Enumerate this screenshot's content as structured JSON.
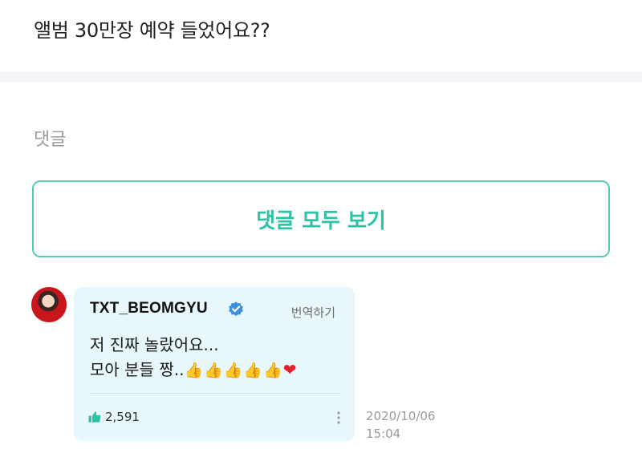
{
  "post": {
    "text": "앨범 30만장 예약 들었어요??"
  },
  "comments_section": {
    "label": "댓글",
    "view_all_label": "댓글 모두 보기"
  },
  "comment": {
    "author": "TXT_BEOMGYU",
    "translate_label": "번역하기",
    "line1": "저 진짜 놀랐어요...",
    "line2": "모아 분들 짱..",
    "emoji_thumbs": "👍👍👍👍👍",
    "emoji_heart": "❤",
    "likes": "2,591",
    "date": "2020/10/06",
    "time": "15:04"
  },
  "icons": {
    "verified": "verified-check-icon",
    "like": "thumbs-up-icon",
    "more": "more-vertical-icon"
  },
  "colors": {
    "accent": "#2cc2a6",
    "accent_border": "#56cdb6",
    "bubble_bg": "#e8f7fc",
    "verified_blue": "#3d8fe0",
    "heart_red": "#e0202a"
  }
}
